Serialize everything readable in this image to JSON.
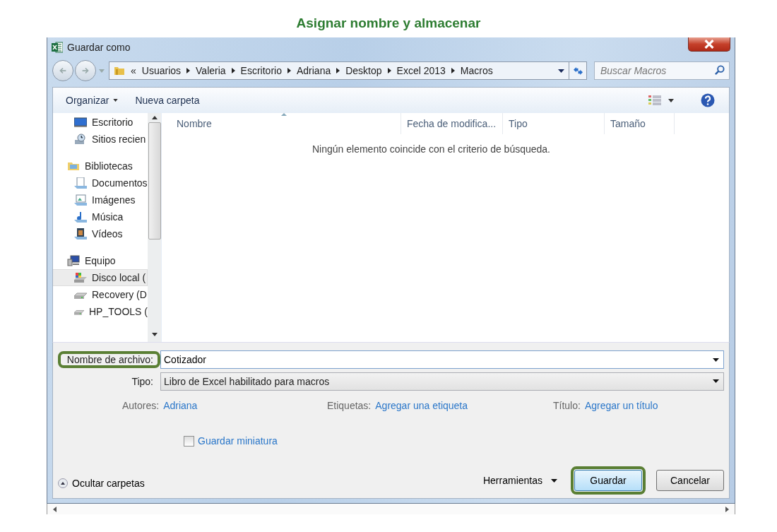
{
  "heading": "Asignar nombre y almacenar",
  "window": {
    "title": "Guardar como"
  },
  "address": {
    "prefix": "«",
    "crumbs": [
      "Usuarios",
      "Valeria",
      "Escritorio",
      "Adriana",
      "Desktop",
      "Excel 2013",
      "Macros"
    ]
  },
  "search": {
    "placeholder": "Buscar Macros"
  },
  "toolbar": {
    "organize": "Organizar",
    "new_folder": "Nueva carpeta"
  },
  "sidebar": {
    "sections": [
      {
        "children": [
          {
            "label": "Escritorio",
            "selected": false
          },
          {
            "label": "Sitios recien",
            "selected": false
          }
        ]
      },
      {
        "label": "Bibliotecas",
        "children": [
          {
            "label": "Documentos",
            "selected": false
          },
          {
            "label": "Imágenes",
            "selected": false
          },
          {
            "label": "Música",
            "selected": false
          },
          {
            "label": "Vídeos",
            "selected": false
          }
        ]
      },
      {
        "label": "Equipo",
        "children": [
          {
            "label": "Disco local (",
            "selected": true
          },
          {
            "label": "Recovery (D",
            "selected": false
          },
          {
            "label": "HP_TOOLS (",
            "selected": false
          }
        ]
      }
    ]
  },
  "columns": [
    {
      "label": "Nombre",
      "sorted": true
    },
    {
      "label": "Fecha de modifica...",
      "sorted": false
    },
    {
      "label": "Tipo",
      "sorted": false
    },
    {
      "label": "Tamaño",
      "sorted": false
    }
  ],
  "empty_message": "Ningún elemento coincide con el criterio de búsqueda.",
  "filename": {
    "label": "Nombre de archivo:",
    "value": "Cotizador",
    "highlighted": true
  },
  "filetype": {
    "label": "Tipo:",
    "value": "Libro de Excel habilitado para macros"
  },
  "metadata": [
    {
      "label": "Autores:",
      "value": "Adriana"
    },
    {
      "label": "Etiquetas:",
      "value": "Agregar una etiqueta"
    },
    {
      "label": "Título:",
      "value": "Agregar un título"
    }
  ],
  "thumbnail": {
    "label": "Guardar miniatura",
    "checked": false
  },
  "hide_folders": "Ocultar carpetas",
  "tools": "Herramientas",
  "buttons": [
    {
      "label": "Guardar",
      "kind": "primary",
      "highlighted": true
    },
    {
      "label": "Cancelar",
      "kind": "default",
      "highlighted": false
    }
  ]
}
